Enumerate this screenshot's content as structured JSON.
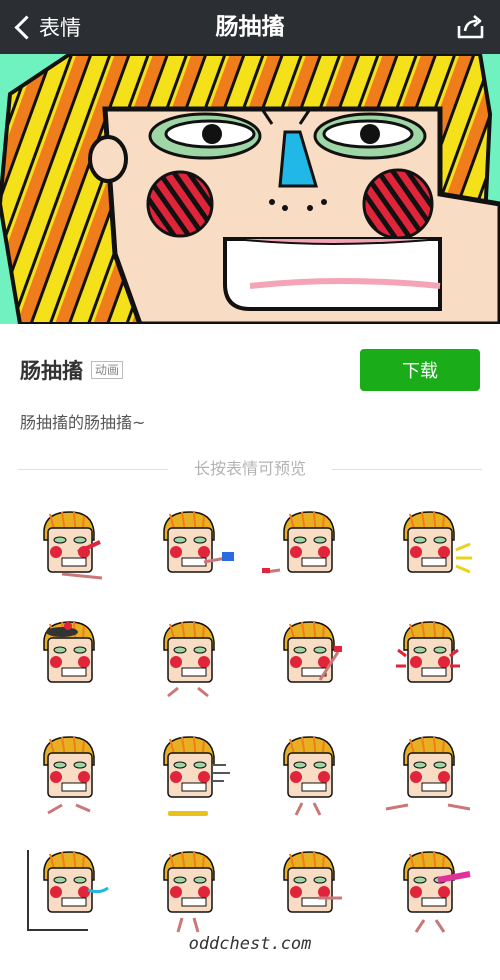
{
  "nav": {
    "back_label": "表情",
    "title": "肠抽搐"
  },
  "package": {
    "title": "肠抽搐",
    "tag": "动画",
    "download_label": "下载",
    "description": "肠抽搐的肠抽搐~"
  },
  "preview": {
    "hint": "长按表情可预览"
  },
  "stickers": [
    {
      "pose": "lying-tongue"
    },
    {
      "pose": "kick-shoe"
    },
    {
      "pose": "crawl"
    },
    {
      "pose": "shout"
    },
    {
      "pose": "hat-stand"
    },
    {
      "pose": "squat"
    },
    {
      "pose": "kick-up"
    },
    {
      "pose": "scream"
    },
    {
      "pose": "run"
    },
    {
      "pose": "skateboard"
    },
    {
      "pose": "big-head"
    },
    {
      "pose": "split"
    },
    {
      "pose": "wall-spit"
    },
    {
      "pose": "stand"
    },
    {
      "pose": "lean"
    },
    {
      "pose": "laser"
    }
  ],
  "watermark": "oddchest.com",
  "colors": {
    "nav": "#2b2e33",
    "accent": "#1aad19",
    "banner_bg": "#6ff2c0"
  }
}
